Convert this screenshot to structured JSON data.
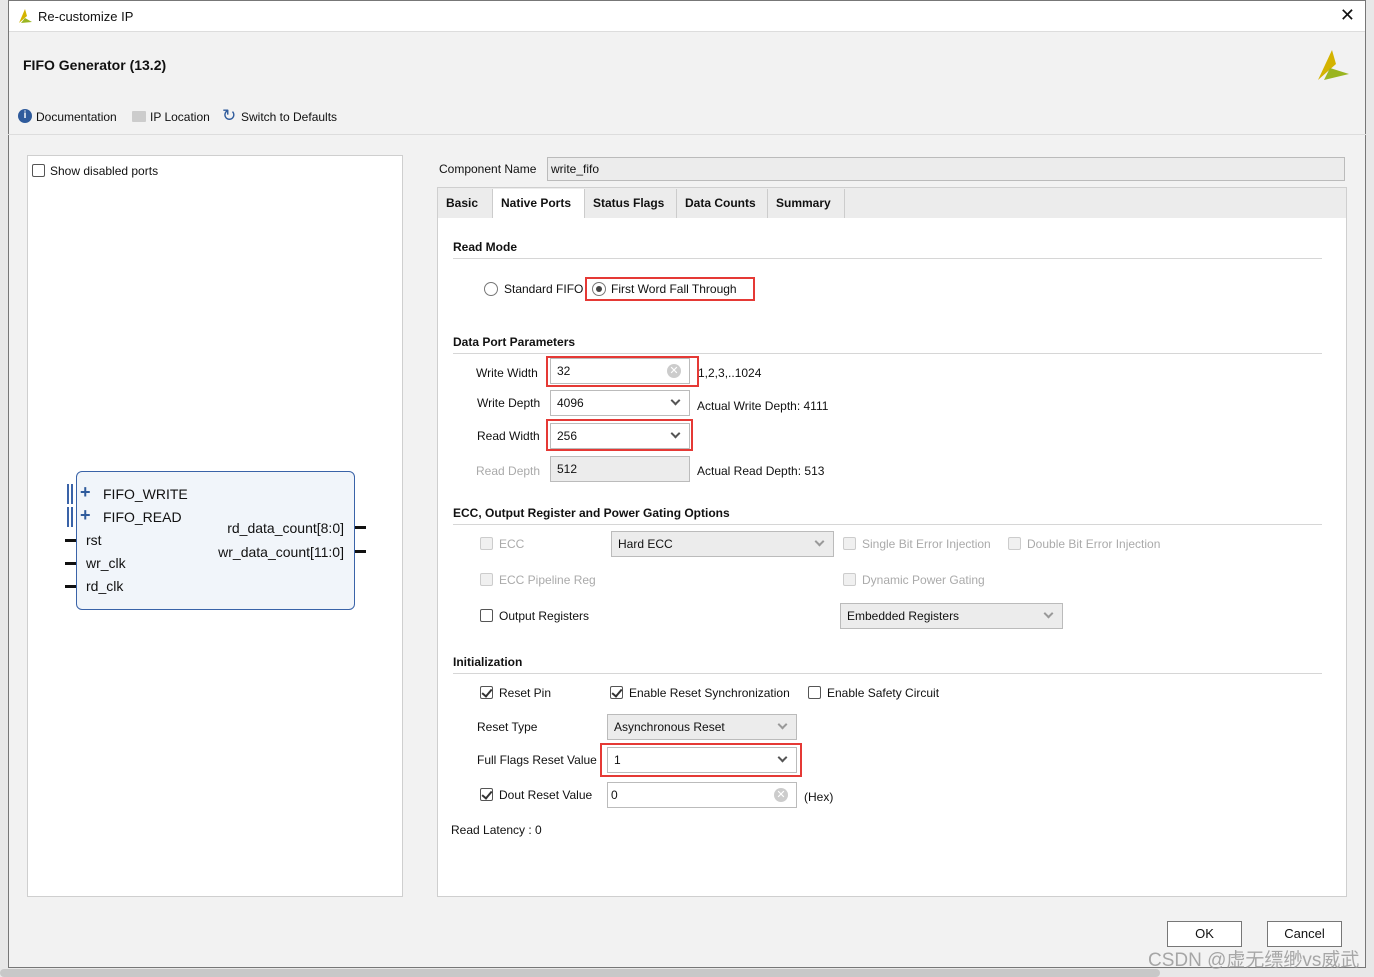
{
  "window": {
    "title": "Re-customize IP"
  },
  "header": {
    "title": "FIFO Generator (13.2)",
    "documentation": "Documentation",
    "ip_location": "IP Location",
    "switch_defaults": "Switch to Defaults"
  },
  "left": {
    "show_disabled": "Show disabled ports",
    "symbol": {
      "bus_left": [
        "FIFO_WRITE",
        "FIFO_READ"
      ],
      "pins_left": [
        "rst",
        "wr_clk",
        "rd_clk"
      ],
      "pins_right": [
        "rd_data_count[8:0]",
        "wr_data_count[11:0]"
      ]
    }
  },
  "component": {
    "label": "Component Name",
    "value": "write_fifo"
  },
  "tabs": [
    "Basic",
    "Native Ports",
    "Status Flags",
    "Data Counts",
    "Summary"
  ],
  "read_mode": {
    "title": "Read Mode",
    "opt1": "Standard FIFO",
    "opt2": "First Word Fall Through",
    "selected": "First Word Fall Through"
  },
  "data_port": {
    "title": "Data Port Parameters",
    "write_width_label": "Write Width",
    "write_width": "32",
    "write_width_range": "1,2,3,..1024",
    "write_depth_label": "Write Depth",
    "write_depth": "4096",
    "actual_write_depth": "Actual Write Depth: 4111",
    "read_width_label": "Read Width",
    "read_width": "256",
    "read_depth_label": "Read Depth",
    "read_depth": "512",
    "actual_read_depth": "Actual Read Depth: 513"
  },
  "ecc": {
    "title": "ECC, Output Register and Power Gating Options",
    "ecc": "ECC",
    "ecc_type": "Hard ECC",
    "single_bit": "Single Bit Error Injection",
    "double_bit": "Double Bit Error Injection",
    "ecc_pipeline": "ECC Pipeline Reg",
    "dynamic_power": "Dynamic Power Gating",
    "output_regs": "Output Registers",
    "output_reg_type": "Embedded Registers"
  },
  "init": {
    "title": "Initialization",
    "reset_pin": "Reset Pin",
    "enable_reset_sync": "Enable Reset Synchronization",
    "enable_safety": "Enable Safety Circuit",
    "reset_type_label": "Reset Type",
    "reset_type": "Asynchronous Reset",
    "full_flags_label": "Full Flags Reset Value",
    "full_flags": "1",
    "dout_reset_label": "Dout Reset Value",
    "dout_reset": "0",
    "hex": "(Hex)"
  },
  "read_latency": "Read Latency : 0",
  "buttons": {
    "ok": "OK",
    "cancel": "Cancel"
  },
  "watermark": "CSDN @虚无缥缈vs威武"
}
